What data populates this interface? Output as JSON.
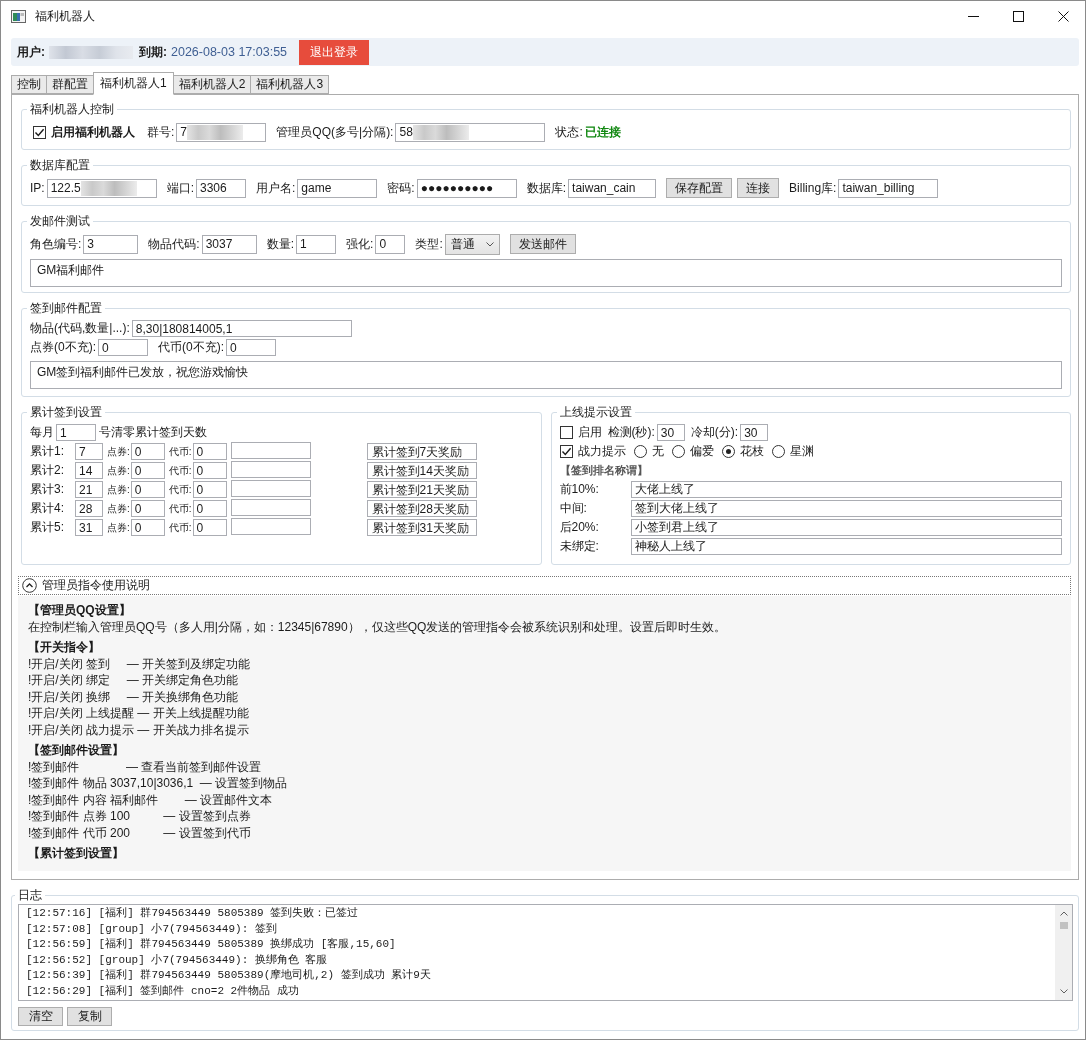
{
  "window": {
    "title": "福利机器人"
  },
  "user_bar": {
    "user_label": "用户:",
    "user_redacted": true,
    "expiry_label": "到期:",
    "expiry": "2026-08-03 17:03:55",
    "logout_button": "退出登录"
  },
  "tabs": [
    {
      "label": "控制",
      "selected": false
    },
    {
      "label": "群配置",
      "selected": false
    },
    {
      "label": "福利机器人1",
      "selected": true
    },
    {
      "label": "福利机器人2",
      "selected": false
    },
    {
      "label": "福利机器人3",
      "selected": false
    }
  ],
  "bot_control": {
    "title": "福利机器人控制",
    "enable": {
      "label": "启用福利机器人",
      "checked": true
    },
    "fields": [
      {
        "label": "群号:",
        "value": "7",
        "redacted": true
      },
      {
        "label": "管理员QQ(多号|分隔):",
        "value": "58",
        "redacted": true
      }
    ],
    "status_label": "状态:",
    "status": "已连接",
    "connected": true
  },
  "db_config": {
    "title": "数据库配置",
    "items": [
      {
        "kind": "field",
        "label": "IP:",
        "value": "122.5",
        "redacted": true
      },
      {
        "kind": "field",
        "label": "端口:",
        "value": "3306",
        "redacted": false
      },
      {
        "kind": "field",
        "label": "用户名:",
        "value": "game",
        "redacted": false
      },
      {
        "kind": "field",
        "label": "密码:",
        "value": "●●●●●●●●●●",
        "redacted": false
      },
      {
        "kind": "field",
        "label": "数据库:",
        "value": "taiwan_cain",
        "redacted": false
      },
      {
        "kind": "button",
        "label": "保存配置"
      },
      {
        "kind": "button",
        "label": "连接"
      },
      {
        "kind": "field",
        "label": "Billing库:",
        "value": "taiwan_billing",
        "redacted": false
      }
    ]
  },
  "mail_test": {
    "title": "发邮件测试",
    "items": [
      {
        "kind": "field",
        "label": "角色编号:",
        "value": "3"
      },
      {
        "kind": "field",
        "label": "物品代码:",
        "value": "3037"
      },
      {
        "kind": "field",
        "label": "数量:",
        "value": "1"
      },
      {
        "kind": "field",
        "label": "强化:",
        "value": "0"
      },
      {
        "kind": "select",
        "label": "类型:",
        "value": "普通"
      },
      {
        "kind": "button",
        "label": "发送邮件"
      }
    ],
    "message": "GM福利邮件"
  },
  "signin_mail": {
    "title": "签到邮件配置",
    "items_field": {
      "label": "物品(代码,数量|...):",
      "value": "8,30|180814005,1"
    },
    "points_field": {
      "label": "点券(0不充):",
      "value": "0"
    },
    "coin_field": {
      "label": "代币(0不充):",
      "value": "0"
    },
    "message": "GM签到福利邮件已发放，祝您游戏愉快"
  },
  "cumulative": {
    "title": "累计签到设置",
    "reset_prefix": "每月",
    "reset_day": "1",
    "reset_suffix": "号清零累计签到天数",
    "rows": [
      {
        "label": "累计1:",
        "days": "7",
        "points_label": "点券:",
        "points": "0",
        "coin_label": "代币:",
        "coin": "0",
        "reward_button": "累计签到7天奖励"
      },
      {
        "label": "累计2:",
        "days": "14",
        "points_label": "点券:",
        "points": "0",
        "coin_label": "代币:",
        "coin": "0",
        "reward_button": "累计签到14天奖励"
      },
      {
        "label": "累计3:",
        "days": "21",
        "points_label": "点券:",
        "points": "0",
        "coin_label": "代币:",
        "coin": "0",
        "reward_button": "累计签到21天奖励"
      },
      {
        "label": "累计4:",
        "days": "28",
        "points_label": "点券:",
        "points": "0",
        "coin_label": "代币:",
        "coin": "0",
        "reward_button": "累计签到28天奖励"
      },
      {
        "label": "累计5:",
        "days": "31",
        "points_label": "点券:",
        "points": "0",
        "coin_label": "代币:",
        "coin": "0",
        "reward_button": "累计签到31天奖励"
      }
    ]
  },
  "online_tips": {
    "title": "上线提示设置",
    "enable": {
      "label": "启用",
      "checked": false
    },
    "detect_label": "检测(秒):",
    "detect": "30",
    "cooldown_label": "冷却(分):",
    "cooldown": "30",
    "power_tip": {
      "label": "战力提示",
      "checked": true
    },
    "rank_options": [
      {
        "label": "无",
        "selected": false
      },
      {
        "label": "偏爱",
        "selected": false
      },
      {
        "label": "花枝",
        "selected": true
      },
      {
        "label": "星渊",
        "selected": false
      }
    ],
    "titles_heading": "【签到排名称谓】",
    "titles": [
      {
        "label": "前10%:",
        "value": "大佬上线了"
      },
      {
        "label": "中间:",
        "value": "签到大佬上线了"
      },
      {
        "label": "后20%:",
        "value": "小签到君上线了"
      },
      {
        "label": "未绑定:",
        "value": "神秘人上线了"
      }
    ]
  },
  "help": {
    "title": "管理员指令使用说明",
    "expanded": true,
    "sections": [
      {
        "heading": "【管理员QQ设置】",
        "lines": [
          "在控制栏输入管理员QQ号（多人用|分隔，如：12345|67890），仅这些QQ发送的管理指令会被系统识别和处理。设置后即时生效。"
        ]
      },
      {
        "heading": "【开关指令】",
        "lines": [
          "!开启/关闭 签到     — 开关签到及绑定功能",
          "!开启/关闭 绑定     — 开关绑定角色功能",
          "!开启/关闭 换绑     — 开关换绑角色功能",
          "!开启/关闭 上线提醒 — 开关上线提醒功能",
          "!开启/关闭 战力提示 — 开关战力排名提示"
        ]
      },
      {
        "heading": "【签到邮件设置】",
        "lines": [
          "!签到邮件              — 查看当前签到邮件设置",
          "!签到邮件 物品 3037,10|3036,1  — 设置签到物品",
          "!签到邮件 内容 福利邮件        — 设置邮件文本",
          "!签到邮件 点券 100          — 设置签到点券",
          "!签到邮件 代币 200          — 设置签到代币"
        ]
      },
      {
        "heading": "【累计签到设置】"
      }
    ]
  },
  "log": {
    "title": "日志",
    "lines": [
      "[12:57:16] [福利] 群794563449 5805389 签到失败：已签过",
      "[12:57:08] [group] 小7(794563449): 签到",
      "[12:56:59] [福利] 群794563449 5805389 换绑成功 [客服,15,60]",
      "[12:56:52] [group] 小7(794563449): 换绑角色 客服",
      "[12:56:39] [福利] 群794563449 5805389(摩地司机,2) 签到成功 累计9天",
      "[12:56:29] [福利] 签到邮件 cno=2 2件物品 成功"
    ],
    "buttons": [
      "清空",
      "复制"
    ]
  }
}
